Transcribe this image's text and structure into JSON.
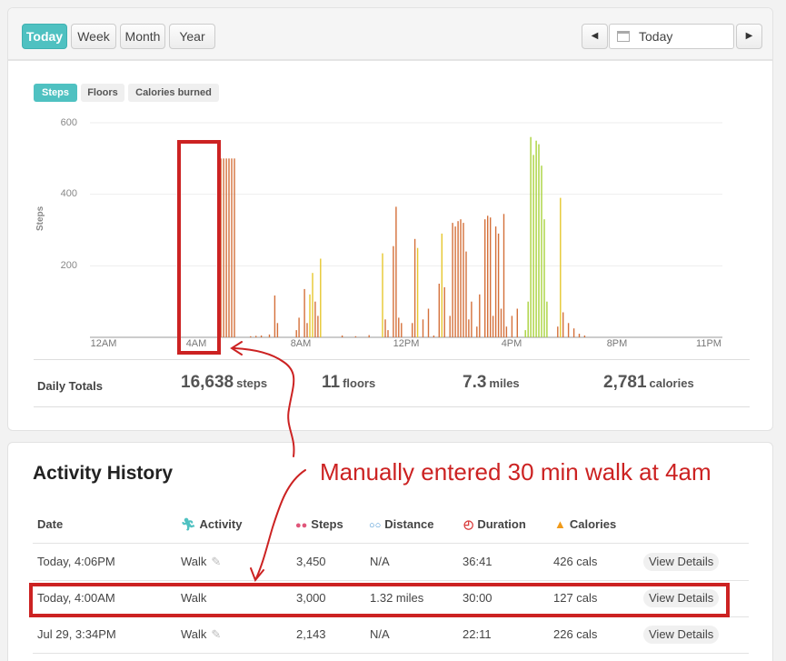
{
  "toolbar": {
    "ranges": [
      "Today",
      "Week",
      "Month",
      "Year"
    ],
    "active_range": "Today",
    "date_value": "Today",
    "prev_icon": "chevron-left-icon",
    "next_icon": "chevron-right-icon"
  },
  "metrics_tabs": [
    "Steps",
    "Floors",
    "Calories burned"
  ],
  "accent_color": "#4fc1c1",
  "annotation_color": "#cc2222",
  "chart_data": {
    "type": "bar",
    "ylabel": "Steps",
    "ylim": [
      0,
      600
    ],
    "yticks": [
      600,
      400,
      200
    ],
    "xticks": [
      "12AM",
      "4AM",
      "8AM",
      "12PM",
      "4PM",
      "8PM",
      "11PM"
    ],
    "x_unit": "hour of day",
    "colors": {
      "orange": "#d4703a",
      "yellow": "#e6c72e",
      "green": "#a9d23b"
    },
    "bars": [
      [
        4.4,
        500,
        "o"
      ],
      [
        4.5,
        500,
        "o"
      ],
      [
        4.6,
        500,
        "o"
      ],
      [
        4.7,
        500,
        "o"
      ],
      [
        4.8,
        500,
        "o"
      ],
      [
        4.9,
        500,
        "o"
      ],
      [
        5.0,
        500,
        "o"
      ],
      [
        5.6,
        3,
        "o"
      ],
      [
        5.8,
        4,
        "o"
      ],
      [
        6.0,
        5,
        "o"
      ],
      [
        6.3,
        8,
        "o"
      ],
      [
        6.5,
        117,
        "o"
      ],
      [
        6.6,
        40,
        "o"
      ],
      [
        7.3,
        20,
        "o"
      ],
      [
        7.4,
        55,
        "o"
      ],
      [
        7.6,
        135,
        "o"
      ],
      [
        7.7,
        40,
        "o"
      ],
      [
        7.8,
        120,
        "y"
      ],
      [
        7.9,
        180,
        "y"
      ],
      [
        8.0,
        100,
        "o"
      ],
      [
        8.1,
        60,
        "o"
      ],
      [
        8.2,
        220,
        "y"
      ],
      [
        9.0,
        5,
        "o"
      ],
      [
        9.5,
        3,
        "o"
      ],
      [
        10.0,
        6,
        "o"
      ],
      [
        10.5,
        235,
        "y"
      ],
      [
        10.6,
        50,
        "o"
      ],
      [
        10.7,
        20,
        "o"
      ],
      [
        10.9,
        255,
        "o"
      ],
      [
        11.0,
        365,
        "o"
      ],
      [
        11.1,
        55,
        "o"
      ],
      [
        11.2,
        40,
        "o"
      ],
      [
        11.6,
        40,
        "o"
      ],
      [
        11.7,
        275,
        "o"
      ],
      [
        11.8,
        250,
        "y"
      ],
      [
        12.0,
        50,
        "o"
      ],
      [
        12.2,
        80,
        "o"
      ],
      [
        12.4,
        5,
        "o"
      ],
      [
        12.6,
        150,
        "o"
      ],
      [
        12.7,
        290,
        "y"
      ],
      [
        12.8,
        140,
        "o"
      ],
      [
        13.0,
        60,
        "o"
      ],
      [
        13.1,
        320,
        "o"
      ],
      [
        13.2,
        310,
        "o"
      ],
      [
        13.3,
        325,
        "o"
      ],
      [
        13.4,
        330,
        "o"
      ],
      [
        13.5,
        320,
        "o"
      ],
      [
        13.6,
        240,
        "o"
      ],
      [
        13.7,
        50,
        "o"
      ],
      [
        13.8,
        100,
        "o"
      ],
      [
        14.0,
        30,
        "o"
      ],
      [
        14.1,
        120,
        "o"
      ],
      [
        14.3,
        330,
        "o"
      ],
      [
        14.4,
        340,
        "o"
      ],
      [
        14.5,
        335,
        "o"
      ],
      [
        14.6,
        60,
        "o"
      ],
      [
        14.7,
        310,
        "o"
      ],
      [
        14.8,
        290,
        "o"
      ],
      [
        14.9,
        80,
        "o"
      ],
      [
        15.0,
        345,
        "o"
      ],
      [
        15.1,
        30,
        "o"
      ],
      [
        15.3,
        60,
        "o"
      ],
      [
        15.5,
        80,
        "o"
      ],
      [
        15.8,
        20,
        "g"
      ],
      [
        15.9,
        100,
        "g"
      ],
      [
        16.0,
        560,
        "g"
      ],
      [
        16.1,
        510,
        "g"
      ],
      [
        16.2,
        550,
        "g"
      ],
      [
        16.3,
        540,
        "g"
      ],
      [
        16.4,
        480,
        "g"
      ],
      [
        16.5,
        330,
        "g"
      ],
      [
        16.6,
        100,
        "g"
      ],
      [
        17.0,
        30,
        "o"
      ],
      [
        17.1,
        390,
        "y"
      ],
      [
        17.2,
        70,
        "o"
      ],
      [
        17.4,
        40,
        "o"
      ],
      [
        17.6,
        25,
        "o"
      ],
      [
        17.8,
        10,
        "o"
      ],
      [
        18.0,
        5,
        "o"
      ]
    ]
  },
  "totals": {
    "label": "Daily Totals",
    "steps_value": "16,638",
    "steps_unit": "steps",
    "floors_value": "11",
    "floors_unit": "floors",
    "miles_value": "7.3",
    "miles_unit": "miles",
    "calories_value": "2,781",
    "calories_unit": "calories"
  },
  "history": {
    "title": "Activity History",
    "annotation": "Manually entered 30 min walk at 4am",
    "columns": {
      "date": "Date",
      "activity": "Activity",
      "steps": "Steps",
      "distance": "Distance",
      "duration": "Duration",
      "calories": "Calories"
    },
    "column_icons": [
      "walker-icon",
      "footprints-icon",
      "distance-icon",
      "stopwatch-icon",
      "flame-icon"
    ],
    "rows": [
      {
        "date": "Today, 4:06PM",
        "activity": "Walk",
        "steps": "3,450",
        "distance": "N/A",
        "duration": "36:41",
        "calories": "426 cals",
        "action": "View Details",
        "editable": true
      },
      {
        "date": "Today, 4:00AM",
        "activity": "Walk",
        "steps": "3,000",
        "distance": "1.32 miles",
        "duration": "30:00",
        "calories": "127 cals",
        "action": "View Details",
        "editable": false
      },
      {
        "date": "Jul 29, 3:34PM",
        "activity": "Walk",
        "steps": "2,143",
        "distance": "N/A",
        "duration": "22:11",
        "calories": "226 cals",
        "action": "View Details",
        "editable": true
      }
    ]
  }
}
